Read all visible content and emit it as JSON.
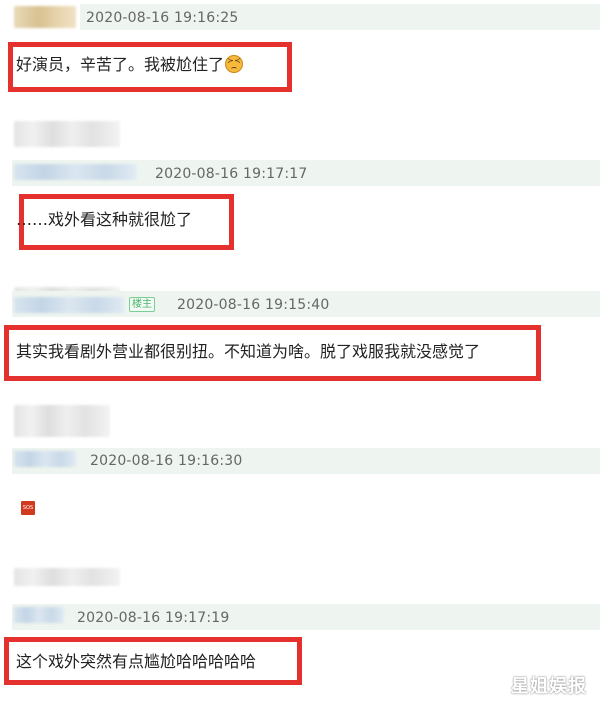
{
  "comments": [
    {
      "timestamp": "2020-08-16 19:16:25",
      "text": "好演员，辛苦了。我被尬住了"
    },
    {
      "timestamp": "2020-08-16 19:17:17",
      "text": "……戏外看这种就很尬了"
    },
    {
      "timestamp": "2020-08-16 19:15:40",
      "badge": "楼主",
      "text": "其实我看剧外营业都很别扭。不知道为啥。脱了戏服我就没感觉了"
    },
    {
      "timestamp": "2020-08-16 19:16:30",
      "sticker": "SOS"
    },
    {
      "timestamp": "2020-08-16 19:17:19",
      "text": "这个戏外突然有点尴尬哈哈哈哈哈"
    }
  ],
  "watermark": "星姐娱报",
  "icons": {
    "emoji": "grimacing-face-emoji",
    "sticker": "sos-sticker"
  },
  "colors": {
    "highlight_border": "#e5312e",
    "meta_bar": "#eef4ef",
    "timestamp": "#666666"
  }
}
